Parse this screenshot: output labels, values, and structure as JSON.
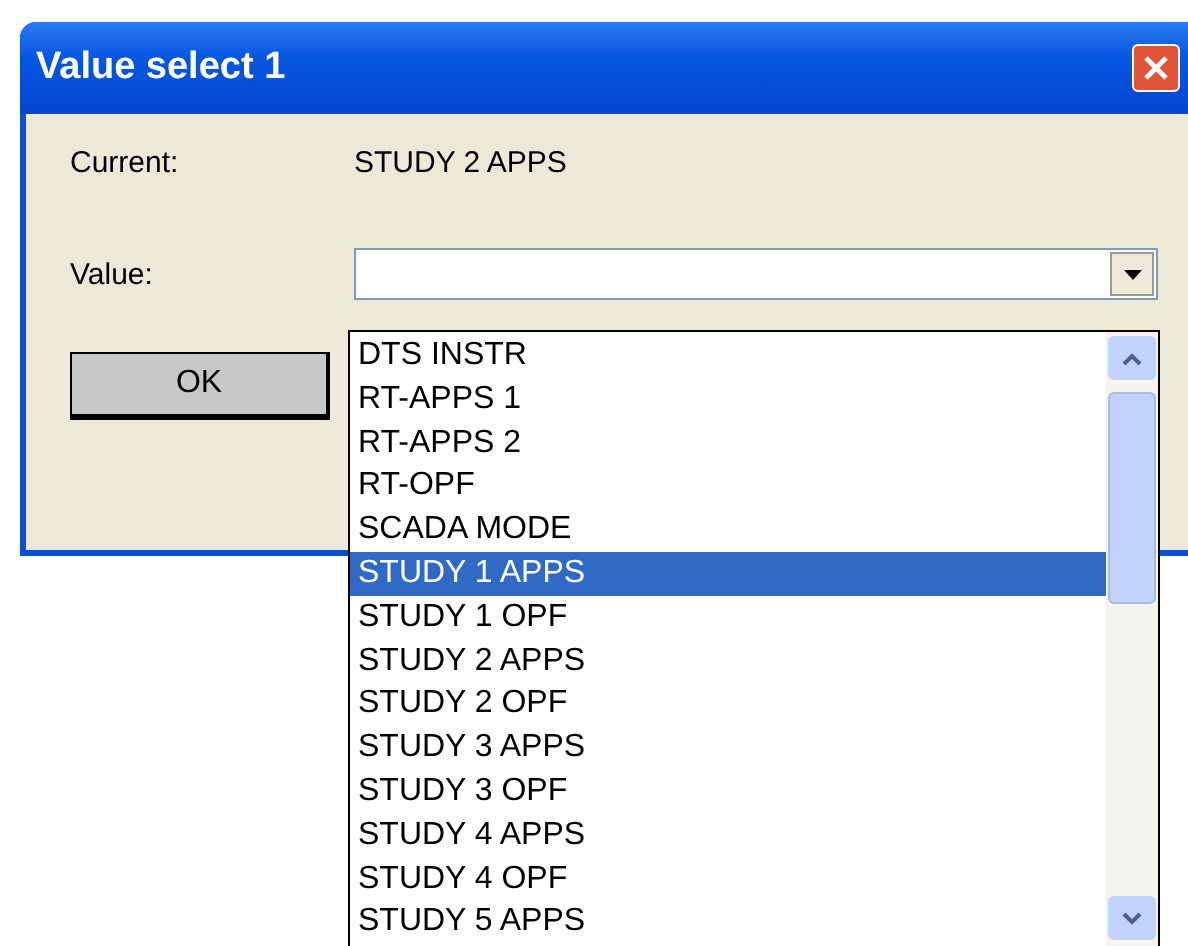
{
  "window": {
    "title": "Value select 1"
  },
  "current": {
    "label": "Current:",
    "value": "STUDY 2 APPS"
  },
  "value_field": {
    "label": "Value:"
  },
  "buttons": [
    {
      "label": "OK"
    }
  ],
  "dropdown": {
    "items": [
      {
        "label": "DTS INSTR",
        "selected": false
      },
      {
        "label": "RT-APPS 1",
        "selected": false
      },
      {
        "label": "RT-APPS 2",
        "selected": false
      },
      {
        "label": "RT-OPF",
        "selected": false
      },
      {
        "label": "SCADA MODE",
        "selected": false
      },
      {
        "label": "STUDY 1 APPS",
        "selected": true
      },
      {
        "label": "STUDY 1 OPF",
        "selected": false
      },
      {
        "label": "STUDY 2 APPS",
        "selected": false
      },
      {
        "label": "STUDY 2 OPF",
        "selected": false
      },
      {
        "label": "STUDY 3 APPS",
        "selected": false
      },
      {
        "label": "STUDY 3 OPF",
        "selected": false
      },
      {
        "label": "STUDY 4 APPS",
        "selected": false
      },
      {
        "label": "STUDY 4 OPF",
        "selected": false
      },
      {
        "label": "STUDY 5 APPS",
        "selected": false
      }
    ]
  }
}
